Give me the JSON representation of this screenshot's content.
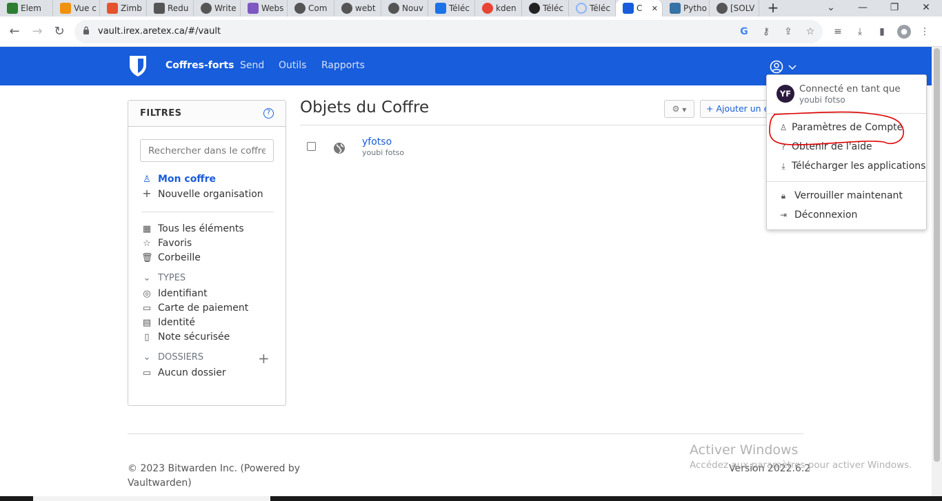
{
  "browser": {
    "tabs": [
      {
        "label": "Elem",
        "color": "#2e7d32"
      },
      {
        "label": "Vue c",
        "color": "#f29111"
      },
      {
        "label": "Zimb",
        "color": "#e5532d"
      },
      {
        "label": "Redu",
        "color": "#555555"
      },
      {
        "label": "Write",
        "color": "#555555"
      },
      {
        "label": "Webs",
        "color": "#7e57c2"
      },
      {
        "label": "Com",
        "color": "#555555"
      },
      {
        "label": "webt",
        "color": "#555555"
      },
      {
        "label": "Nouv",
        "color": "#555555"
      },
      {
        "label": "Téléc",
        "color": "#1a73e8"
      },
      {
        "label": "kden",
        "color": "#ea4335"
      },
      {
        "label": "Téléc",
        "color": "#222222"
      },
      {
        "label": "Téléc",
        "color": "#8ab4f8"
      },
      {
        "label": "C",
        "color": "#175ddc"
      },
      {
        "label": "Pytho",
        "color": "#3572a5"
      },
      {
        "label": "[SOLV",
        "color": "#555555"
      }
    ],
    "new_tab": "+",
    "url": "vault.irex.aretex.ca/#/vault",
    "window_controls": [
      "⌄",
      "—",
      "❐",
      "✕"
    ]
  },
  "nav": {
    "links": [
      "Coffres-forts",
      "Send",
      "Outils",
      "Rapports"
    ],
    "accent": "#175ddc"
  },
  "filters": {
    "title": "FILTRES",
    "help": "?",
    "search_placeholder": "Rechercher dans le coffre",
    "my_vault": "Mon coffre",
    "new_org": "Nouvelle organisation",
    "all_items": "Tous les éléments",
    "favorites": "Favoris",
    "trash": "Corbeille",
    "types_label": "TYPES",
    "types": [
      "Identifiant",
      "Carte de paiement",
      "Identité",
      "Note sécurisée"
    ],
    "folders_label": "DOSSIERS",
    "no_folder": "Aucun dossier"
  },
  "main": {
    "title": "Objets du Coffre",
    "add_button": "+ Ajouter un élément",
    "items": [
      {
        "name": "yfotso",
        "username": "youbi fotso"
      }
    ]
  },
  "footer": {
    "copyright": "© 2023 Bitwarden Inc. (Powered by Vaultwarden)",
    "version": "Version 2022.6.2"
  },
  "watermark": {
    "title": "Activer Windows",
    "subtitle": "Accédez aux paramètres pour activer Windows."
  },
  "account_menu": {
    "initials": "YF",
    "logged_in_as": "Connecté en tant que",
    "user": "youbi fotso",
    "items": [
      "Paramètres de Compte",
      "Obtenir de l'aide",
      "Télécharger les applications"
    ],
    "lock": "Verrouiller maintenant",
    "logout": "Déconnexion",
    "annotation_color": "#e00000"
  }
}
